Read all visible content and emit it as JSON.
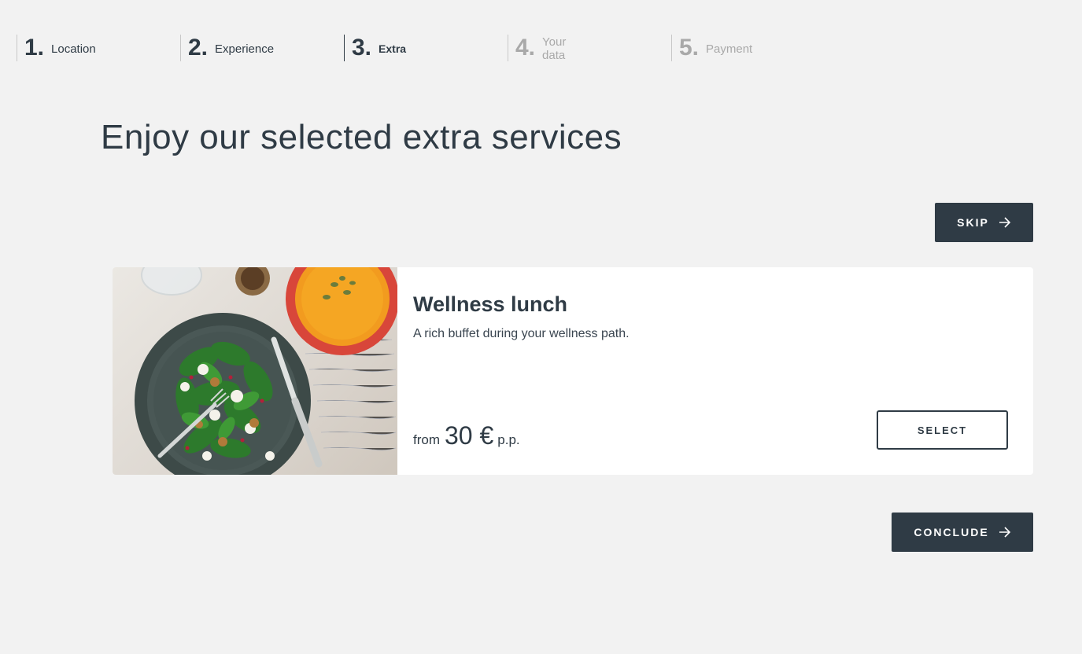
{
  "stepper": {
    "steps": [
      {
        "number": "1.",
        "label": "Location",
        "state": "done"
      },
      {
        "number": "2.",
        "label": "Experience",
        "state": "done"
      },
      {
        "number": "3.",
        "label": "Extra",
        "state": "active"
      },
      {
        "number": "4.",
        "label": "Your data",
        "state": "future"
      },
      {
        "number": "5.",
        "label": "Payment",
        "state": "future"
      }
    ]
  },
  "page": {
    "title": "Enjoy our selected extra services"
  },
  "actions": {
    "skip_label": "SKIP",
    "conclude_label": "CONCLUDE"
  },
  "service": {
    "title": "Wellness lunch",
    "description": "A rich buffet during your wellness path.",
    "price_prefix": "from",
    "price_amount": "30 €",
    "price_suffix": "p.p.",
    "select_label": "SELECT",
    "image_icon": "salad-plate-photo"
  },
  "colors": {
    "primary": "#2f3b45",
    "background": "#f2f2f2",
    "inactive": "#a9a9a9"
  }
}
